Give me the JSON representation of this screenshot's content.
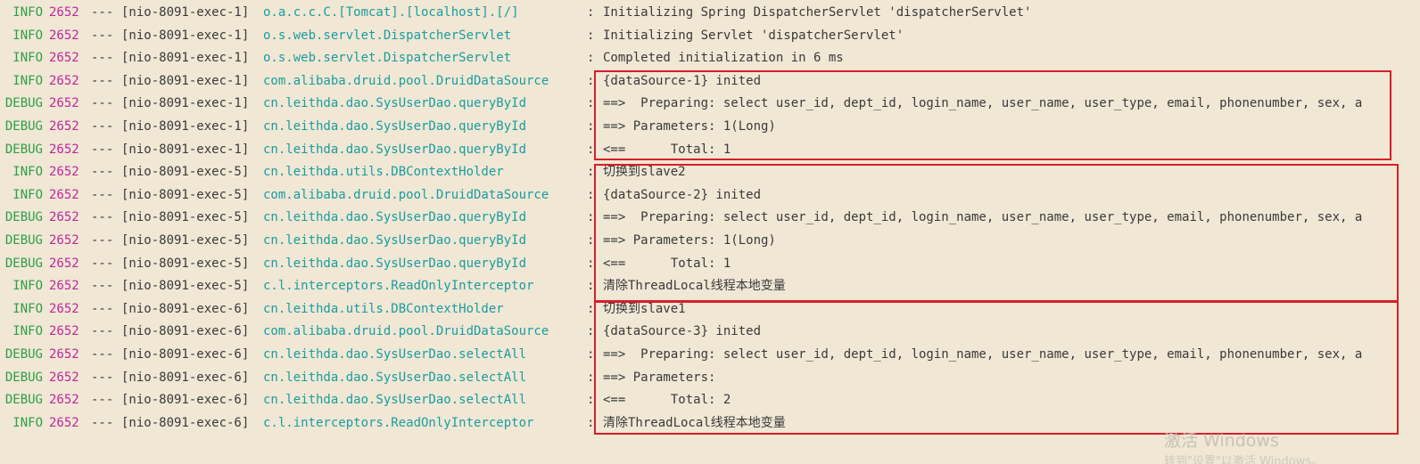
{
  "colors": {
    "background": "#f0e7d5",
    "level": "#2e9e46",
    "pid": "#c2269b",
    "logger": "#1a9d9d",
    "text": "#3a3a3a",
    "highlight_box": "#d51f2a"
  },
  "log_lines": [
    {
      "level": "INFO",
      "pid": "2652",
      "sep": "---",
      "thread": "[nio-8091-exec-1]",
      "logger": "o.a.c.c.C.[Tomcat].[localhost].[/]",
      "colon": ":",
      "message": "Initializing Spring DispatcherServlet 'dispatcherServlet'"
    },
    {
      "level": "INFO",
      "pid": "2652",
      "sep": "---",
      "thread": "[nio-8091-exec-1]",
      "logger": "o.s.web.servlet.DispatcherServlet",
      "colon": ":",
      "message": "Initializing Servlet 'dispatcherServlet'"
    },
    {
      "level": "INFO",
      "pid": "2652",
      "sep": "---",
      "thread": "[nio-8091-exec-1]",
      "logger": "o.s.web.servlet.DispatcherServlet",
      "colon": ":",
      "message": "Completed initialization in 6 ms"
    },
    {
      "level": "INFO",
      "pid": "2652",
      "sep": "---",
      "thread": "[nio-8091-exec-1]",
      "logger": "com.alibaba.druid.pool.DruidDataSource",
      "colon": ":",
      "message": "{dataSource-1} inited"
    },
    {
      "level": "DEBUG",
      "pid": "2652",
      "sep": "---",
      "thread": "[nio-8091-exec-1]",
      "logger": "cn.leithda.dao.SysUserDao.queryById",
      "colon": ":",
      "message": "==>  Preparing: select user_id, dept_id, login_name, user_name, user_type, email, phonenumber, sex, a"
    },
    {
      "level": "DEBUG",
      "pid": "2652",
      "sep": "---",
      "thread": "[nio-8091-exec-1]",
      "logger": "cn.leithda.dao.SysUserDao.queryById",
      "colon": ":",
      "message": "==> Parameters: 1(Long)"
    },
    {
      "level": "DEBUG",
      "pid": "2652",
      "sep": "---",
      "thread": "[nio-8091-exec-1]",
      "logger": "cn.leithda.dao.SysUserDao.queryById",
      "colon": ":",
      "message": "<==      Total: 1"
    },
    {
      "level": "INFO",
      "pid": "2652",
      "sep": "---",
      "thread": "[nio-8091-exec-5]",
      "logger": "cn.leithda.utils.DBContextHolder",
      "colon": ":",
      "message": "切换到slave2"
    },
    {
      "level": "INFO",
      "pid": "2652",
      "sep": "---",
      "thread": "[nio-8091-exec-5]",
      "logger": "com.alibaba.druid.pool.DruidDataSource",
      "colon": ":",
      "message": "{dataSource-2} inited"
    },
    {
      "level": "DEBUG",
      "pid": "2652",
      "sep": "---",
      "thread": "[nio-8091-exec-5]",
      "logger": "cn.leithda.dao.SysUserDao.queryById",
      "colon": ":",
      "message": "==>  Preparing: select user_id, dept_id, login_name, user_name, user_type, email, phonenumber, sex, a"
    },
    {
      "level": "DEBUG",
      "pid": "2652",
      "sep": "---",
      "thread": "[nio-8091-exec-5]",
      "logger": "cn.leithda.dao.SysUserDao.queryById",
      "colon": ":",
      "message": "==> Parameters: 1(Long)"
    },
    {
      "level": "DEBUG",
      "pid": "2652",
      "sep": "---",
      "thread": "[nio-8091-exec-5]",
      "logger": "cn.leithda.dao.SysUserDao.queryById",
      "colon": ":",
      "message": "<==      Total: 1"
    },
    {
      "level": "INFO",
      "pid": "2652",
      "sep": "---",
      "thread": "[nio-8091-exec-5]",
      "logger": "c.l.interceptors.ReadOnlyInterceptor",
      "colon": ":",
      "message": "清除ThreadLocal线程本地变量"
    },
    {
      "level": "INFO",
      "pid": "2652",
      "sep": "---",
      "thread": "[nio-8091-exec-6]",
      "logger": "cn.leithda.utils.DBContextHolder",
      "colon": ":",
      "message": "切换到slave1"
    },
    {
      "level": "INFO",
      "pid": "2652",
      "sep": "---",
      "thread": "[nio-8091-exec-6]",
      "logger": "com.alibaba.druid.pool.DruidDataSource",
      "colon": ":",
      "message": "{dataSource-3} inited"
    },
    {
      "level": "DEBUG",
      "pid": "2652",
      "sep": "---",
      "thread": "[nio-8091-exec-6]",
      "logger": "cn.leithda.dao.SysUserDao.selectAll",
      "colon": ":",
      "message": "==>  Preparing: select user_id, dept_id, login_name, user_name, user_type, email, phonenumber, sex, a"
    },
    {
      "level": "DEBUG",
      "pid": "2652",
      "sep": "---",
      "thread": "[nio-8091-exec-6]",
      "logger": "cn.leithda.dao.SysUserDao.selectAll",
      "colon": ":",
      "message": "==> Parameters: "
    },
    {
      "level": "DEBUG",
      "pid": "2652",
      "sep": "---",
      "thread": "[nio-8091-exec-6]",
      "logger": "cn.leithda.dao.SysUserDao.selectAll",
      "colon": ":",
      "message": "<==      Total: 2"
    },
    {
      "level": "INFO",
      "pid": "2652",
      "sep": "---",
      "thread": "[nio-8091-exec-6]",
      "logger": "c.l.interceptors.ReadOnlyInterceptor",
      "colon": ":",
      "message": "清除ThreadLocal线程本地变量"
    }
  ],
  "watermark": {
    "title": "激活 Windows",
    "subtitle": "转到\"设置\"以激活 Windows。"
  }
}
